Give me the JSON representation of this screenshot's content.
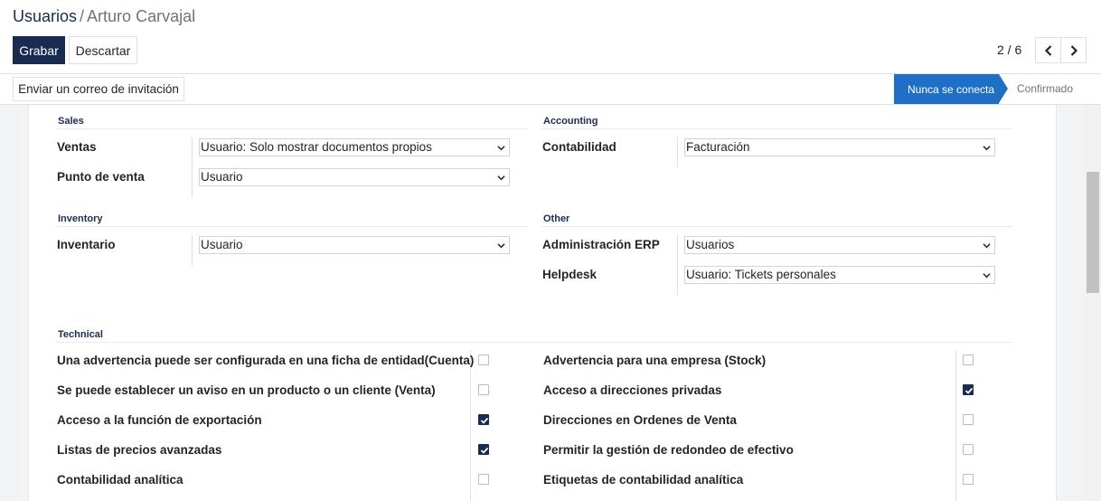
{
  "breadcrumb": {
    "root": "Usuarios",
    "separator": "/",
    "current": "Arturo Carvajal"
  },
  "toolbar": {
    "save_label": "Grabar",
    "discard_label": "Descartar"
  },
  "pager": {
    "value": "2 / 6"
  },
  "statusbar": {
    "invite_label": "Enviar un correo de invitación",
    "stage_active": "Nunca se conecta",
    "stage_next": "Confirmado"
  },
  "groups": {
    "sales": {
      "title": "Sales",
      "ventas_label": "Ventas",
      "ventas_value": "Usuario: Solo mostrar documentos propios",
      "pos_label": "Punto de venta",
      "pos_value": "Usuario"
    },
    "accounting": {
      "title": "Accounting",
      "contabilidad_label": "Contabilidad",
      "contabilidad_value": "Facturación"
    },
    "inventory": {
      "title": "Inventory",
      "inventario_label": "Inventario",
      "inventario_value": "Usuario"
    },
    "other": {
      "title": "Other",
      "erp_label": "Administración ERP",
      "erp_value": "Usuarios",
      "helpdesk_label": "Helpdesk",
      "helpdesk_value": "Usuario: Tickets personales"
    }
  },
  "technical": {
    "title": "Technical",
    "left": [
      {
        "label": "Una advertencia puede ser configurada en una ficha de entidad(Cuenta)",
        "checked": false
      },
      {
        "label": "Se puede establecer un aviso en un producto o un cliente (Venta)",
        "checked": false
      },
      {
        "label": "Acceso a la función de exportación",
        "checked": true
      },
      {
        "label": "Listas de precios avanzadas",
        "checked": true
      },
      {
        "label": "Contabilidad analítica",
        "checked": false
      }
    ],
    "right": [
      {
        "label": "Advertencia para una empresa (Stock)",
        "checked": false
      },
      {
        "label": "Acceso a direcciones privadas",
        "checked": true
      },
      {
        "label": "Direcciones en Ordenes de Venta",
        "checked": false
      },
      {
        "label": "Permitir la gestión de redondeo de efectivo",
        "checked": false
      },
      {
        "label": "Etiquetas de contabilidad analítica",
        "checked": false
      }
    ]
  },
  "colors": {
    "primary": "#1a2b52",
    "stage_active": "#1f6fc6"
  }
}
